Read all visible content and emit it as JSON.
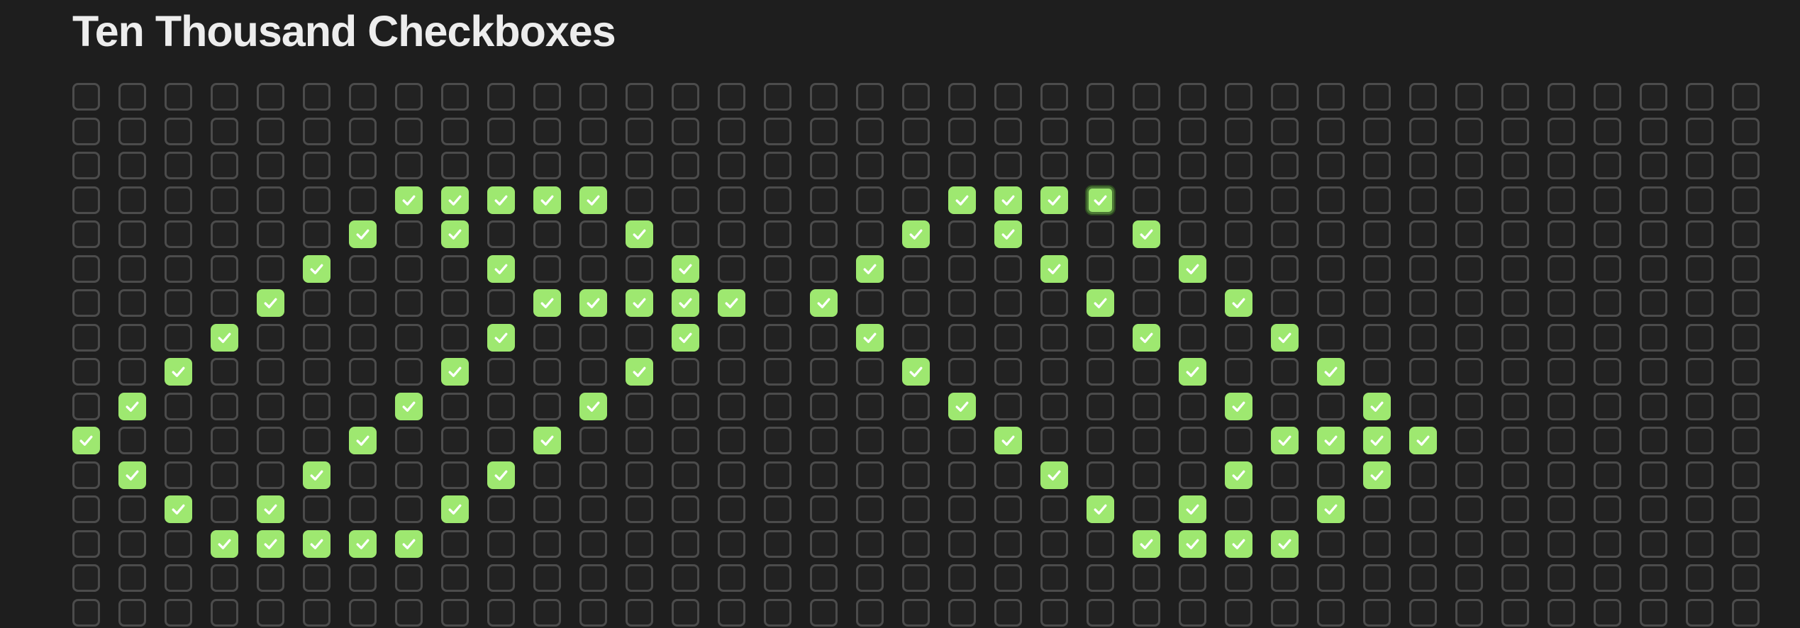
{
  "page": {
    "title": "Ten Thousand Checkboxes"
  },
  "colors": {
    "background": "#1e1e1e",
    "checkbox_border": "#4c4c4c",
    "checked_fill": "#9ee870",
    "check_mark": "#ffffff"
  },
  "checkbox_grid": {
    "columns": 37,
    "visible_rows": 16,
    "checked_icon": "checkmark-icon",
    "focused_cell": [
      3,
      22
    ],
    "checked_cells": [
      [
        3,
        7
      ],
      [
        3,
        8
      ],
      [
        3,
        9
      ],
      [
        3,
        10
      ],
      [
        3,
        11
      ],
      [
        3,
        19
      ],
      [
        3,
        20
      ],
      [
        3,
        21
      ],
      [
        3,
        22
      ],
      [
        4,
        6
      ],
      [
        4,
        8
      ],
      [
        4,
        12
      ],
      [
        4,
        18
      ],
      [
        4,
        20
      ],
      [
        4,
        23
      ],
      [
        5,
        5
      ],
      [
        5,
        9
      ],
      [
        5,
        13
      ],
      [
        5,
        17
      ],
      [
        5,
        21
      ],
      [
        5,
        24
      ],
      [
        6,
        4
      ],
      [
        6,
        10
      ],
      [
        6,
        11
      ],
      [
        6,
        12
      ],
      [
        6,
        13
      ],
      [
        6,
        14
      ],
      [
        6,
        16
      ],
      [
        6,
        22
      ],
      [
        6,
        25
      ],
      [
        7,
        3
      ],
      [
        7,
        9
      ],
      [
        7,
        13
      ],
      [
        7,
        17
      ],
      [
        7,
        23
      ],
      [
        7,
        26
      ],
      [
        8,
        2
      ],
      [
        8,
        8
      ],
      [
        8,
        12
      ],
      [
        8,
        18
      ],
      [
        8,
        24
      ],
      [
        8,
        27
      ],
      [
        9,
        1
      ],
      [
        9,
        7
      ],
      [
        9,
        11
      ],
      [
        9,
        19
      ],
      [
        9,
        25
      ],
      [
        9,
        28
      ],
      [
        10,
        0
      ],
      [
        10,
        6
      ],
      [
        10,
        10
      ],
      [
        10,
        20
      ],
      [
        10,
        26
      ],
      [
        10,
        27
      ],
      [
        10,
        28
      ],
      [
        10,
        29
      ],
      [
        11,
        1
      ],
      [
        11,
        5
      ],
      [
        11,
        9
      ],
      [
        11,
        21
      ],
      [
        11,
        25
      ],
      [
        11,
        28
      ],
      [
        12,
        2
      ],
      [
        12,
        4
      ],
      [
        12,
        8
      ],
      [
        12,
        22
      ],
      [
        12,
        24
      ],
      [
        12,
        27
      ],
      [
        13,
        3
      ],
      [
        13,
        4
      ],
      [
        13,
        5
      ],
      [
        13,
        6
      ],
      [
        13,
        7
      ],
      [
        13,
        23
      ],
      [
        13,
        24
      ],
      [
        13,
        25
      ],
      [
        13,
        26
      ]
    ]
  }
}
